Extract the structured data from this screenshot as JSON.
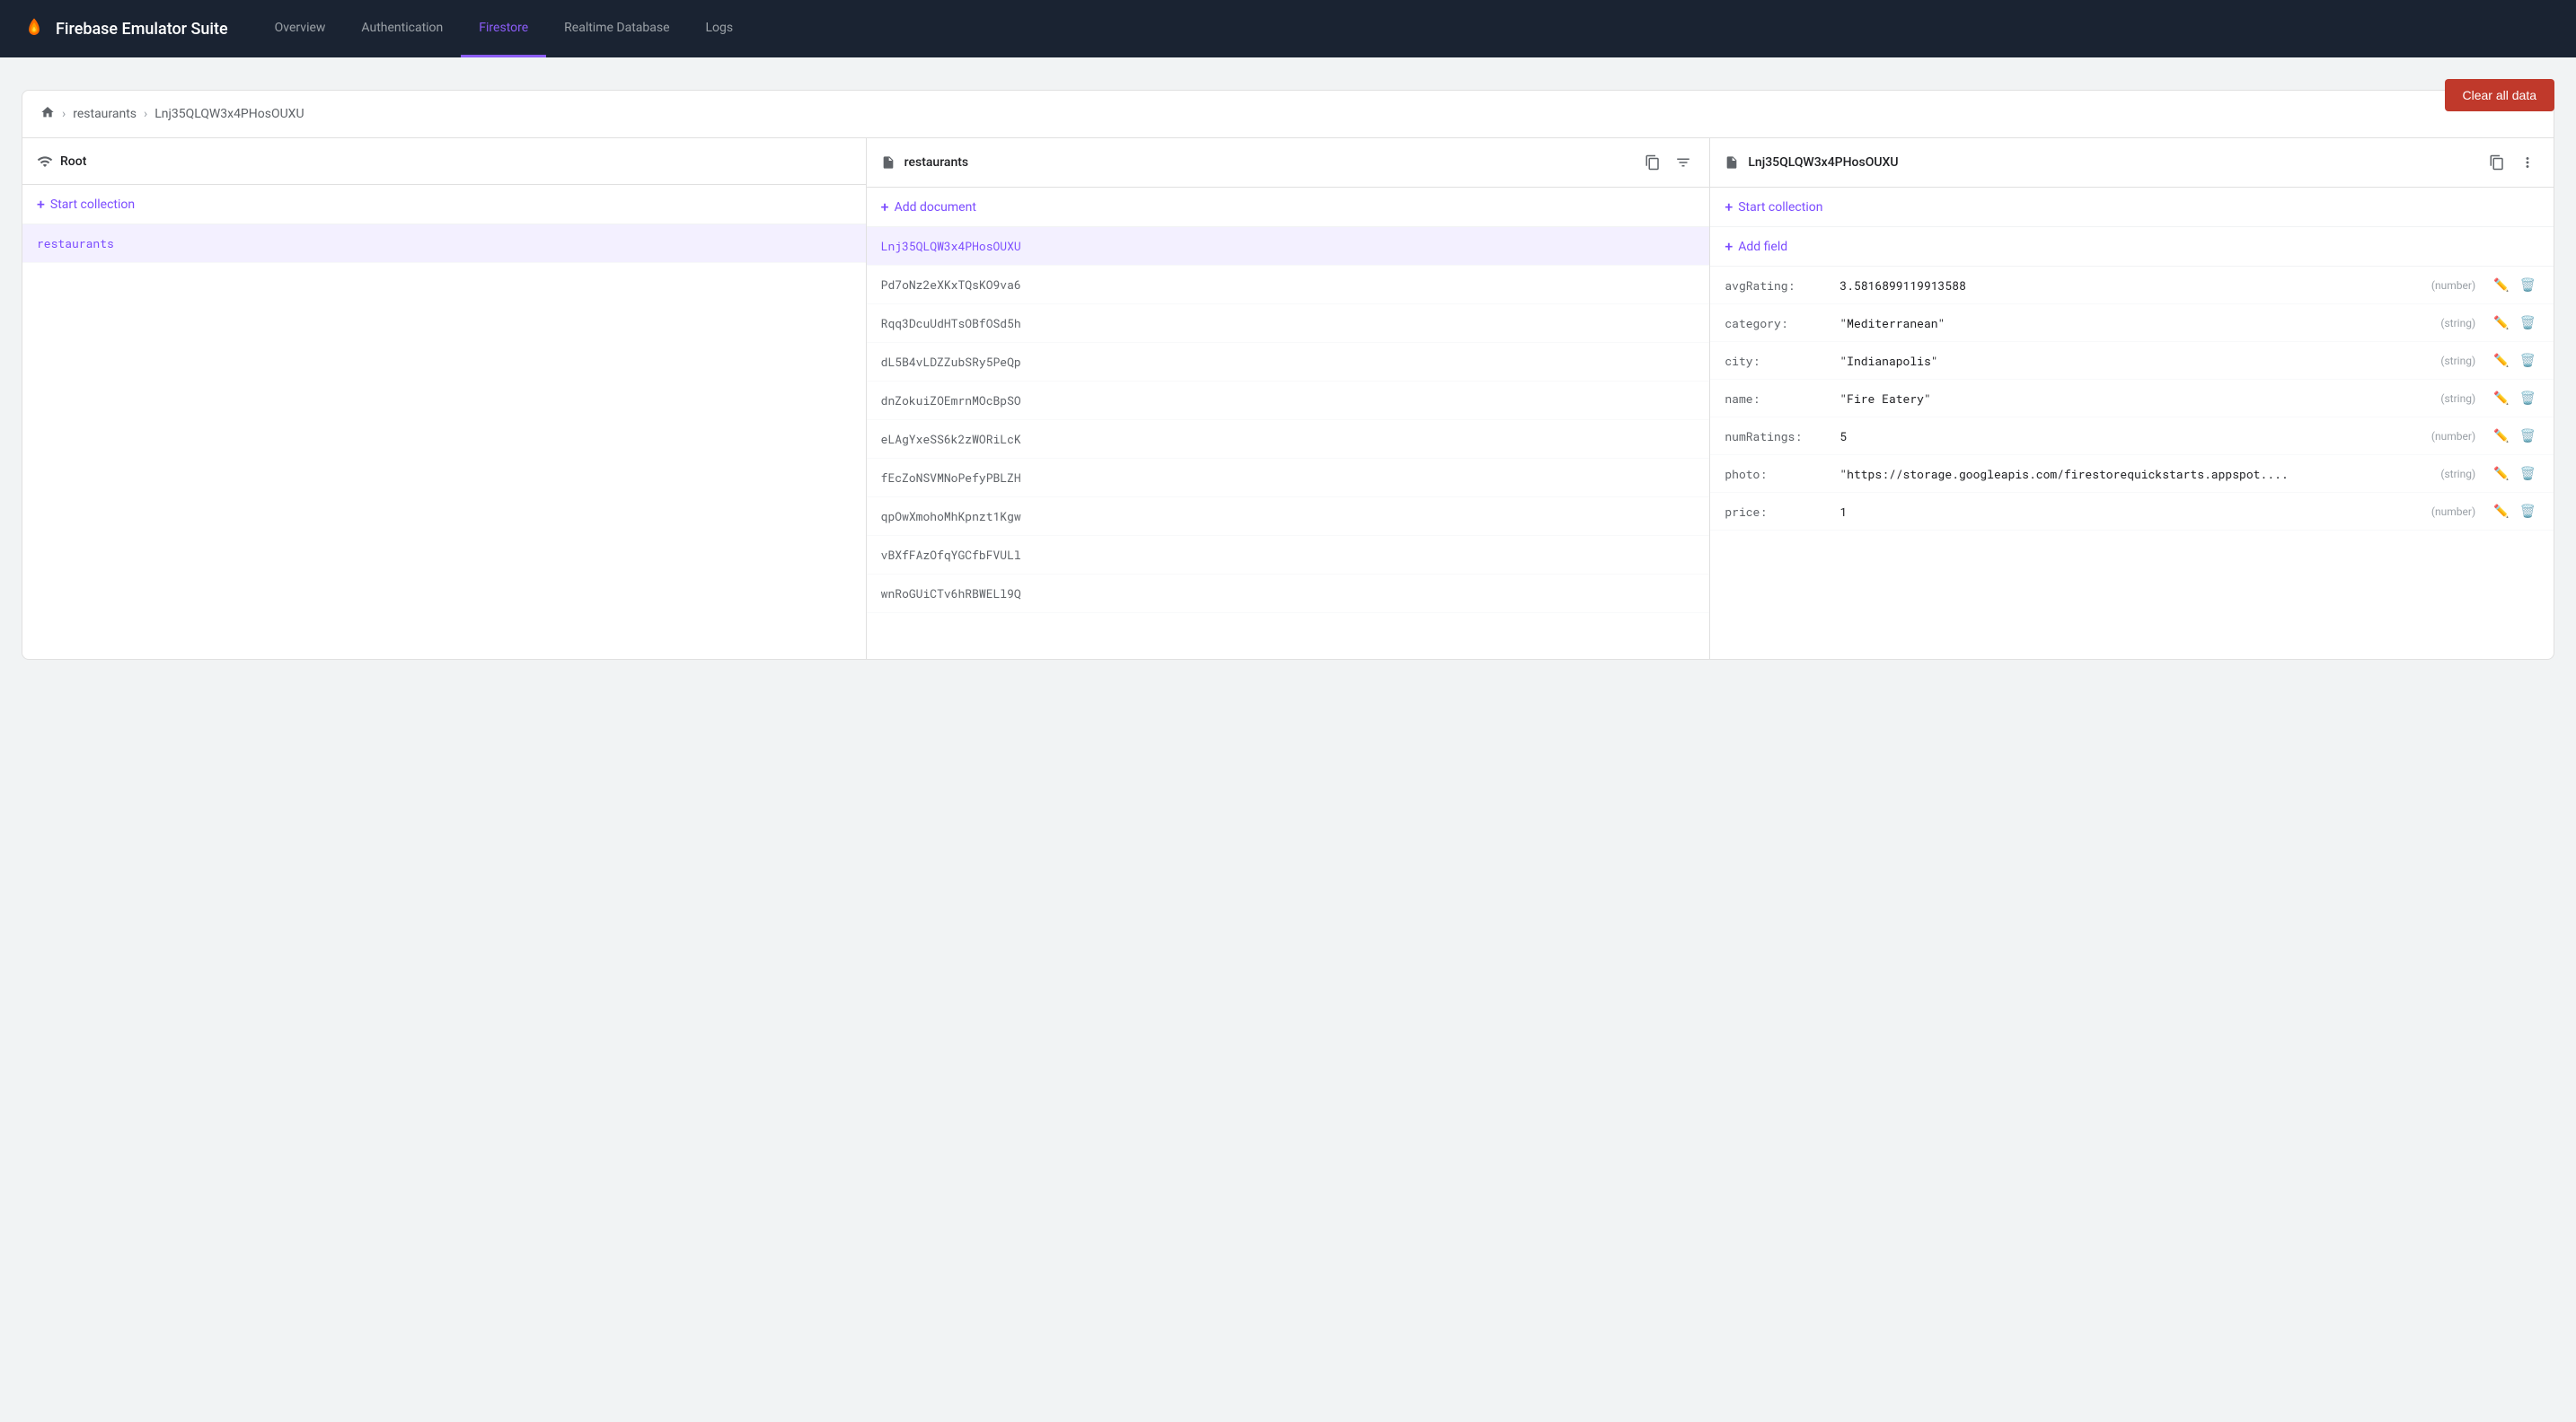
{
  "app": {
    "title": "Firebase Emulator Suite"
  },
  "nav": {
    "items": [
      {
        "id": "overview",
        "label": "Overview",
        "active": false
      },
      {
        "id": "authentication",
        "label": "Authentication",
        "active": false
      },
      {
        "id": "firestore",
        "label": "Firestore",
        "active": true
      },
      {
        "id": "realtime-database",
        "label": "Realtime Database",
        "active": false
      },
      {
        "id": "logs",
        "label": "Logs",
        "active": false
      }
    ],
    "clear_btn": "Clear all data"
  },
  "breadcrumb": {
    "items": [
      {
        "id": "home",
        "label": ""
      },
      {
        "id": "restaurants",
        "label": "restaurants"
      },
      {
        "id": "doc",
        "label": "Lnj35QLQW3x4PHosOUXU"
      }
    ]
  },
  "columns": {
    "root": {
      "title": "Root",
      "add_action": "Start collection",
      "items": [
        {
          "id": "restaurants",
          "label": "restaurants",
          "selected": true
        }
      ]
    },
    "collection": {
      "title": "restaurants",
      "add_action": "Add document",
      "items": [
        {
          "id": "lnj",
          "label": "Lnj35QLQW3x4PHosOUXU",
          "selected": true
        },
        {
          "id": "pd7",
          "label": "Pd7oNz2eXKxTQsKO9va6",
          "selected": false
        },
        {
          "id": "rqq",
          "label": "Rqq3DcuUdHTsOBfOSd5h",
          "selected": false
        },
        {
          "id": "dl5",
          "label": "dL5B4vLDZZubSRy5PeQp",
          "selected": false
        },
        {
          "id": "dnz",
          "label": "dnZokuiZOEmrnMOcBpSO",
          "selected": false
        },
        {
          "id": "ela",
          "label": "eLAgYxeSS6k2zWORiLcK",
          "selected": false
        },
        {
          "id": "fec",
          "label": "fEcZoNSVMNoPefyPBLZH",
          "selected": false
        },
        {
          "id": "qp0",
          "label": "qpOwXmohoMhKpnzt1Kgw",
          "selected": false
        },
        {
          "id": "vbx",
          "label": "vBXfFAzOfqYGCfbFVULl",
          "selected": false
        },
        {
          "id": "wnr",
          "label": "wnRoGUiCTv6hRBWELl9Q",
          "selected": false
        }
      ]
    },
    "document": {
      "title": "Lnj35QLQW3x4PHosOUXU",
      "add_action": "Start collection",
      "add_field": "Add field",
      "fields": [
        {
          "name": "avgRating:",
          "value": "3.5816899119913588",
          "type": "(number)"
        },
        {
          "name": "category:",
          "value": "\"Mediterranean\"",
          "type": "(string)"
        },
        {
          "name": "city:",
          "value": "\"Indianapolis\"",
          "type": "(string)"
        },
        {
          "name": "name:",
          "value": "\"Fire Eatery\"",
          "type": "(string)"
        },
        {
          "name": "numRatings:",
          "value": "5",
          "type": "(number)"
        },
        {
          "name": "photo:",
          "value": "\"https://storage.googleapis.com/firestorequickstarts.appspot....",
          "type": "(string)"
        },
        {
          "name": "price:",
          "value": "1",
          "type": "(number)"
        }
      ]
    }
  }
}
